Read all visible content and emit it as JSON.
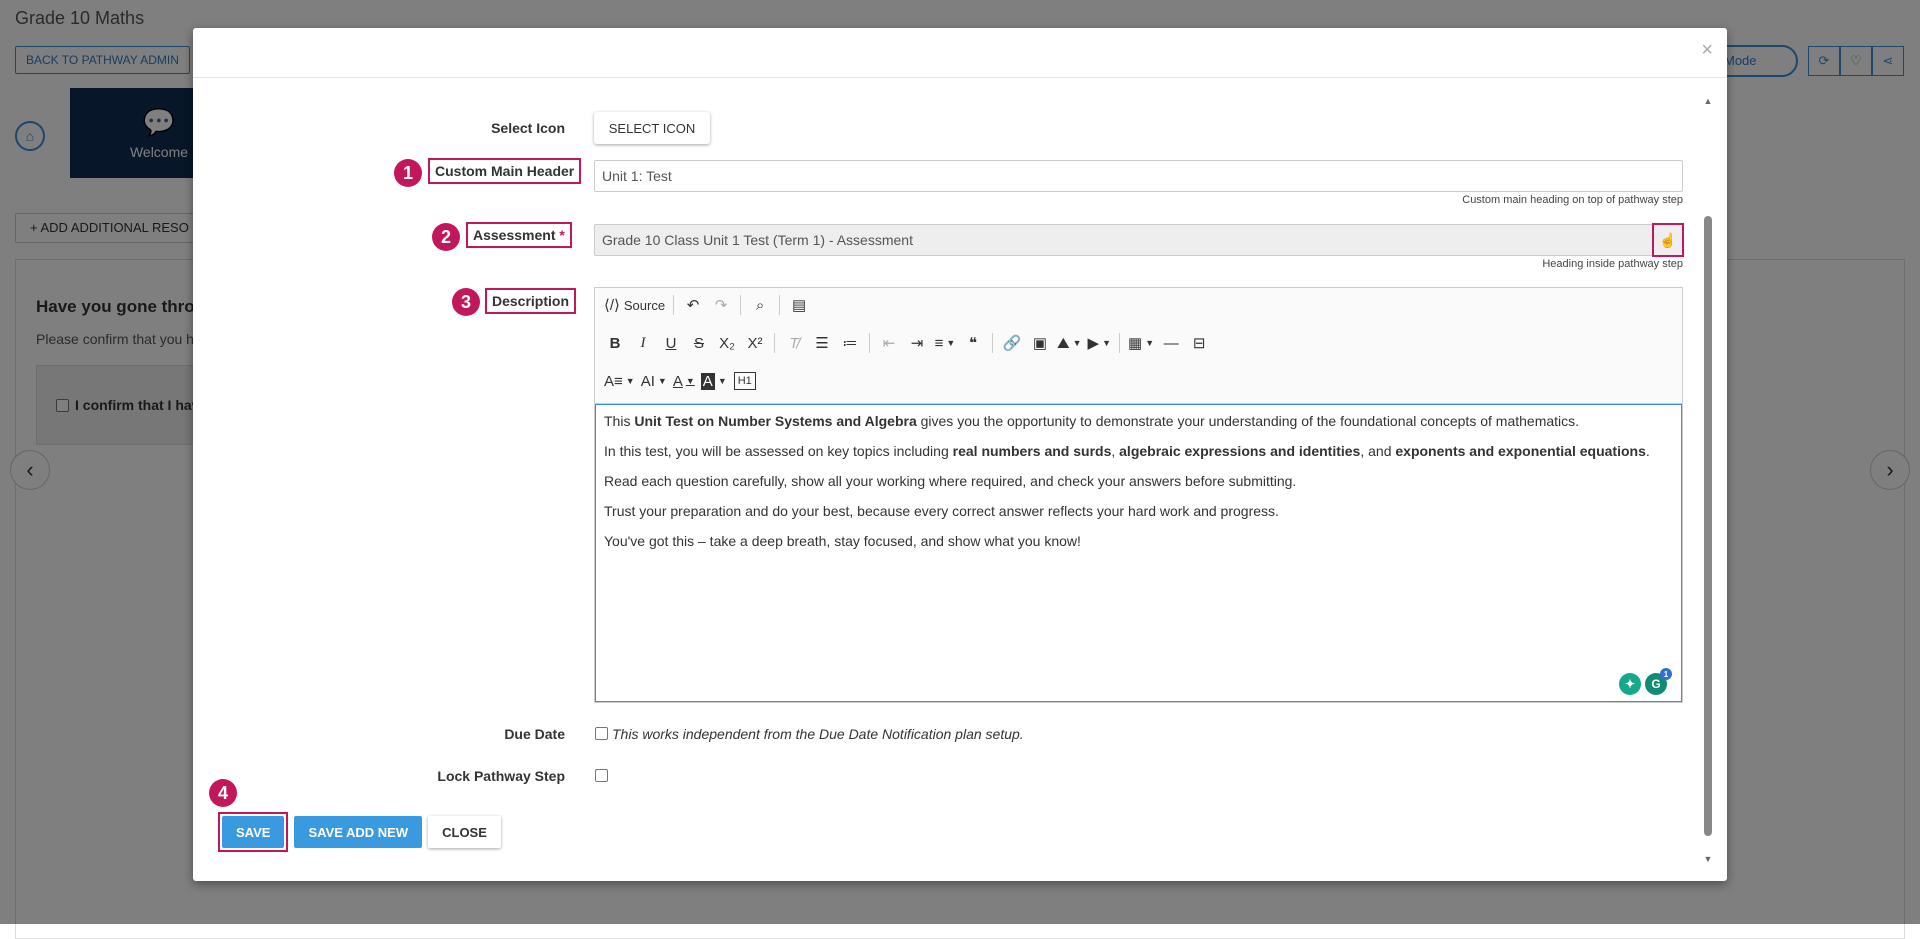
{
  "background": {
    "page_title": "Grade 10 Maths",
    "back_button": "BACK TO PATHWAY ADMIN",
    "welcome_tile": "Welcome",
    "add_resource": "+ ADD ADDITIONAL RESO",
    "question_heading": "Have you gone throug",
    "question_sub": "Please confirm that you h",
    "confirm_label": "I confirm that I hav",
    "mode_label": "Mode"
  },
  "modal": {
    "close_glyph": "×",
    "select_icon": {
      "label": "Select Icon",
      "button": "SELECT ICON"
    },
    "custom_header": {
      "marker": "1",
      "label": "Custom Main Header",
      "value": "Unit 1: Test",
      "help": "Custom main heading on top of pathway step"
    },
    "assessment": {
      "marker": "2",
      "label": "Assessment",
      "required": "*",
      "value": "Grade 10 Class Unit 1 Test (Term 1) - Assessment",
      "help": "Heading inside pathway step"
    },
    "description": {
      "marker": "3",
      "label": "Description",
      "toolbar": {
        "source": "Source"
      },
      "content": {
        "p1_a": "This ",
        "p1_b": "Unit Test on Number Systems and Algebra",
        "p1_c": " gives you the opportunity to demonstrate your understanding of the foundational concepts of mathematics.",
        "p2_a": "In this test, you will be assessed on key topics including ",
        "p2_b": "real numbers and surds",
        "p2_c": ", ",
        "p2_d": "algebraic expressions and identities",
        "p2_e": ", and ",
        "p2_f": "exponents and exponential equations",
        "p2_g": ".",
        "p3": "Read each question carefully, show all your working where required, and check your answers before submitting.",
        "p4": "Trust your preparation and do your best, because every correct answer reflects your hard work and progress.",
        "p5": "You've got this – take a deep breath, stay focused, and show what you know!"
      },
      "grammarly_badge": "1"
    },
    "due_date": {
      "label": "Due Date",
      "note": "This works independent from the Due Date Notification plan setup."
    },
    "lock_step": {
      "label": "Lock Pathway Step"
    },
    "buttons": {
      "marker": "4",
      "save": "SAVE",
      "save_add_new": "SAVE ADD NEW",
      "close": "CLOSE"
    }
  },
  "colors": {
    "accent": "#3a9ae0",
    "highlight": "#c2185b",
    "navy": "#0f2d52"
  }
}
